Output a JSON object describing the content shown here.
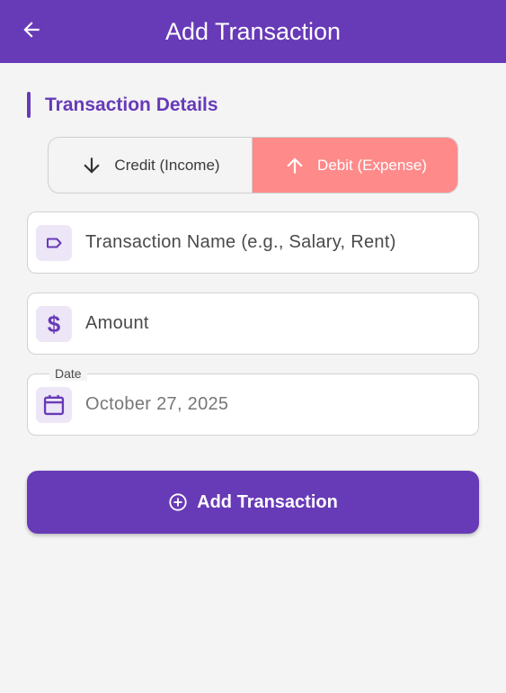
{
  "appbar": {
    "title": "Add Transaction",
    "back_icon": "arrow-left-icon"
  },
  "section": {
    "title": "Transaction Details"
  },
  "type_toggle": {
    "credit_label": "Credit (Income)",
    "debit_label": "Debit (Expense)",
    "selected": "debit",
    "selected_color": "#ff8a8a"
  },
  "fields": {
    "name": {
      "placeholder": "Transaction Name (e.g., Salary, Rent)",
      "icon": "label-tag-icon"
    },
    "amount": {
      "placeholder": "Amount",
      "icon": "dollar-icon"
    },
    "date": {
      "label": "Date",
      "value": "October 27, 2025",
      "icon": "calendar-icon"
    }
  },
  "submit": {
    "label": "Add Transaction",
    "icon": "add-circle-icon"
  },
  "colors": {
    "primary": "#673ab7",
    "icon_bg": "#ece6f7",
    "background": "#f4f4f4"
  }
}
